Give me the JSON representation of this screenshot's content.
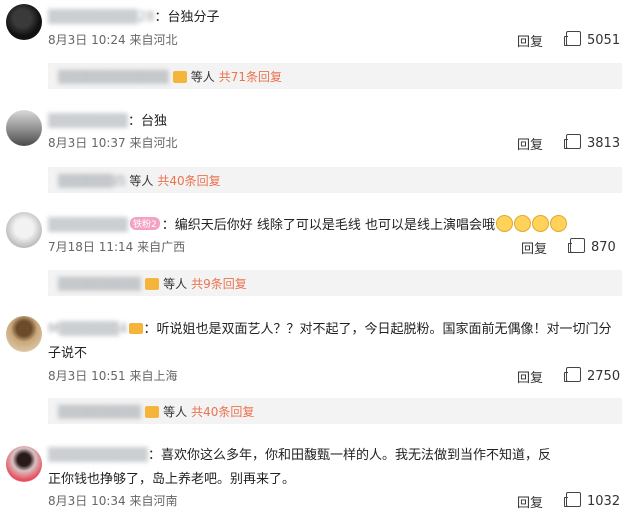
{
  "comments": [
    {
      "user": "▒▒▒▒▒▒▒▒▒28",
      "text": "台独分子",
      "date": "8月3日",
      "time": "10:24",
      "location": "来自河北",
      "reply_label": "回复",
      "likes": "5051",
      "replies": {
        "names": "▒▒▒▒▒▒▒▒▒▒▒▒",
        "and": "等人",
        "count": "共71条回复"
      }
    },
    {
      "user": "▒▒▒▒▒▒▒▒",
      "text": "台独",
      "date": "8月3日",
      "time": "10:37",
      "location": "来自河北",
      "reply_label": "回复",
      "likes": "3813",
      "replies": {
        "names": "▒▒▒▒▒▒四",
        "and": "等人",
        "count": "共40条回复"
      }
    },
    {
      "user": "▒▒▒▒▒▒▒▒",
      "badge": "铁粉2",
      "text": "编织天后你好 线除了可以是毛线 也可以是线上演唱会哦",
      "date": "7月18日",
      "time": "11:14",
      "location": "来自广西",
      "reply_label": "回复",
      "likes": "870",
      "replies": {
        "names": "▒▒▒▒▒▒▒▒▒",
        "and": "等人",
        "count": "共9条回复"
      }
    },
    {
      "user": "M▒▒▒▒▒▒4",
      "text_line1": "听说姐也是双面艺人？？对不起了，今日起脱粉。国家面前无偶像！对一切门分",
      "text_line2": "子说不",
      "date": "8月3日",
      "time": "10:51",
      "location": "来自上海",
      "reply_label": "回复",
      "likes": "2750",
      "replies": {
        "names": "▒▒▒▒▒▒▒▒▒",
        "and": "等人",
        "count": "共40条回复"
      }
    },
    {
      "user": "▒▒▒▒▒▒▒▒▒▒",
      "text_line1": "喜欢你这么多年，你和田馥甄一样的人。我无法做到当作不知道，反",
      "text_line2": "正你钱也挣够了，岛上养老吧。别再来了。",
      "date": "8月3日",
      "time": "10:34",
      "location": "来自河南",
      "reply_label": "回复",
      "likes": "1032"
    }
  ]
}
